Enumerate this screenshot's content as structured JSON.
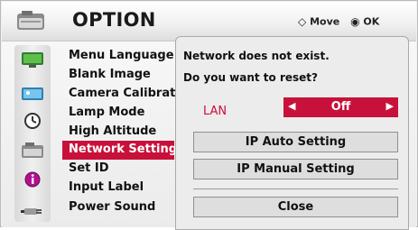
{
  "header": {
    "title": "OPTION",
    "move_hint": "Move",
    "ok_hint": "OK",
    "move_symbol": "◇",
    "ok_symbol": "◉"
  },
  "menu": {
    "items": [
      {
        "label": "Menu Language",
        "icon": "monitor-icon"
      },
      {
        "label": "Blank Image",
        "icon": "picture-icon"
      },
      {
        "label": "Camera Calibration",
        "icon": "picture-icon"
      },
      {
        "label": "Lamp Mode",
        "icon": "clock-icon"
      },
      {
        "label": "High Altitude",
        "icon": "clock-icon"
      },
      {
        "label": "Network Setting",
        "icon": "option-icon"
      },
      {
        "label": "Set ID",
        "icon": "info-icon"
      },
      {
        "label": "Input Label",
        "icon": "info-icon"
      },
      {
        "label": "Power Sound",
        "icon": "plug-icon"
      }
    ],
    "selected_label": "Network Setting"
  },
  "popup": {
    "message_line1": "Network does not exist.",
    "message_line2": "Do you want to reset?",
    "lan_label": "LAN",
    "lan_value": "Off",
    "buttons": {
      "ip_auto": "IP Auto Setting",
      "ip_manual": "IP Manual Setting",
      "close": "Close"
    }
  },
  "colors": {
    "accent": "#c8113a",
    "panel": "#ececec"
  }
}
